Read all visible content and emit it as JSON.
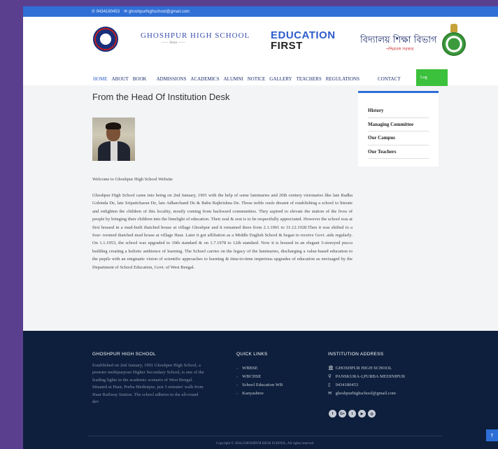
{
  "topbar": {
    "phone": "✆ 9434180453",
    "email": "✉ ghoshpurhighschool@gmail.com"
  },
  "header": {
    "school_name": "GHOSHPUR HIGH SCHOOL",
    "since": "—— Since ——",
    "edu_line1": "EDUCATION",
    "edu_line2": "FIRST",
    "bengali_title": "বিদ্যালয় শিক্ষা বিভাগ",
    "bengali_sub": "পশ্চিমবঙ্গ সরকার"
  },
  "nav": {
    "items": [
      "HOME",
      "ABOUT",
      "BOOK",
      "ADMISSIONS",
      "ACADEMICS",
      "ALUMNI",
      "NOTICE",
      "GALLERY",
      "TEACHERS",
      "REGULATIONS",
      "CONTACT"
    ],
    "login": "Log"
  },
  "main": {
    "title": "From the Head Of Institution Desk",
    "welcome": "Welcome to Ghoshpur High School Website",
    "body": "Ghoshpur High School came into being on 2nd January, 1901 with the help of some luminaries and 20th century visionaries like late Radha Gobinda De, late Sripaticharan De, late Adharchand De & Babu Rajkrishna De. Those noble souls dreamt of establishing a school to literate and enlighten the children of this locality, mostly coming from backward communities. They aspired to elevate the station of the lives of people by bringing their children into the limelight of education. Their zeal & zest is to be respectfully appreciated. However the school was at first housed in a mud-built thatched house at village Ghoshpur and it remained there from 2.1.1901 to 31.12.1928.Then it was shifted to a four- roomed thatched mud house at village Haur. Later it got affiliation as a Middle English School & began to receive Govt. aids regularly. On 1.1.1953, the school was upgraded to 10th standard & on 1.7.1978 to 12th standard. Now it is housed in an elegant 3-storeyed pucca building creating a holistic ambience of learning. The School carries on the legacy of the luminaries, discharging a value-based education to the pupils with an enigmatic vision of scientific approaches to learning & time-to-time imperious upgrades of education as envisaged by the Department of School Education, Govt. of West Bengal."
  },
  "sidebar": {
    "items": [
      "History",
      "Managing Committee",
      "Our Campus",
      "Our Teachers"
    ]
  },
  "footer": {
    "about_title": "GHOSHPUR HIGH SCHOOL",
    "about_text": "Established on 2nd January, 1901 Ghoshpur High School, a premier multipurpose Higher Secondary School, is one of the leading lights in the academic scenario of West Bengal. Situated at Haur, Purba Medinipur, just 5 minutes' walk from Haur Railway Station. The school adheres to the all-round dev",
    "links_title": "QUICK LINKS",
    "links": [
      "WBBSE",
      "WBCHSE",
      "School Education WB",
      "Kanyashree"
    ],
    "addr_title": "INSTITUTION ADDRESS",
    "addr": [
      {
        "icon": "🏛",
        "text": "GHOSHPUR HIGH SCHOOL"
      },
      {
        "icon": "⚲",
        "text": "PANSKURA-I,PURBA MEDINIPUR"
      },
      {
        "icon": "▯",
        "text": "9434180453"
      },
      {
        "icon": "✉",
        "text": "ghoshpurhighschool@gmail.com"
      }
    ],
    "socials": [
      "f",
      "G+",
      "t",
      "▶",
      "◎"
    ],
    "copyright": "Copyright © 2024,GHOSHPUR HIGH SCHOOL, All rights reserved"
  },
  "to_top": "↑"
}
